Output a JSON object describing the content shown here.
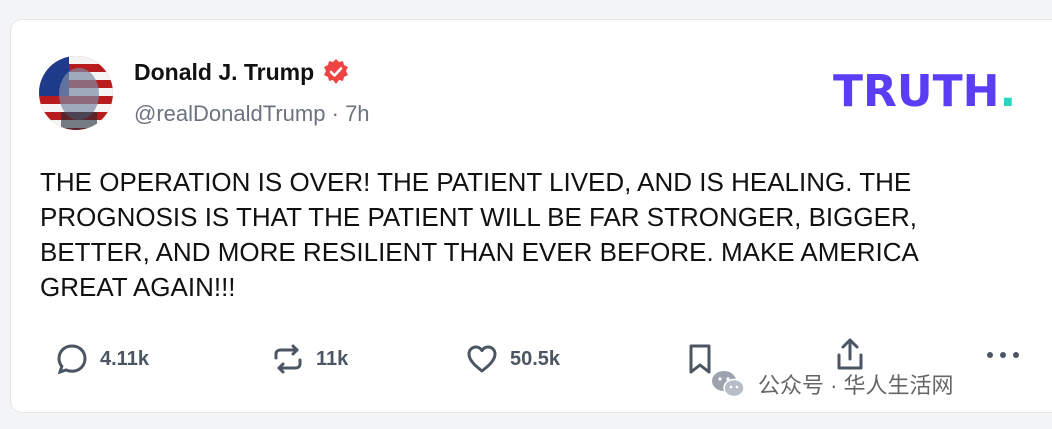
{
  "post": {
    "author_name": "Donald J. Trump",
    "handle": "@realDonaldTrump",
    "separator": "·",
    "time_ago": "7h",
    "text": "THE OPERATION IS OVER! THE PATIENT LIVED, AND IS HEALING. THE PROGNOSIS IS THAT THE PATIENT WILL BE FAR STRONGER, BIGGER, BETTER, AND MORE RESILIENT THAN EVER BEFORE. MAKE AMERICA GREAT AGAIN!!!"
  },
  "brand": {
    "logo_text": "TRUTH",
    "logo_dot": ".",
    "logo_color": "#5b3df5",
    "dot_color": "#2dd4bf"
  },
  "actions": {
    "reply_count": "4.11k",
    "retruth_count": "11k",
    "like_count": "50.5k",
    "icons": [
      "reply-icon",
      "retruth-icon",
      "like-icon",
      "bookmark-icon",
      "share-icon",
      "more-icon"
    ]
  },
  "watermark": {
    "text": "公众号 · 华人生活网"
  },
  "colors": {
    "verified_badge": "#ef4444",
    "text": "#111111",
    "muted": "#6b7280"
  }
}
